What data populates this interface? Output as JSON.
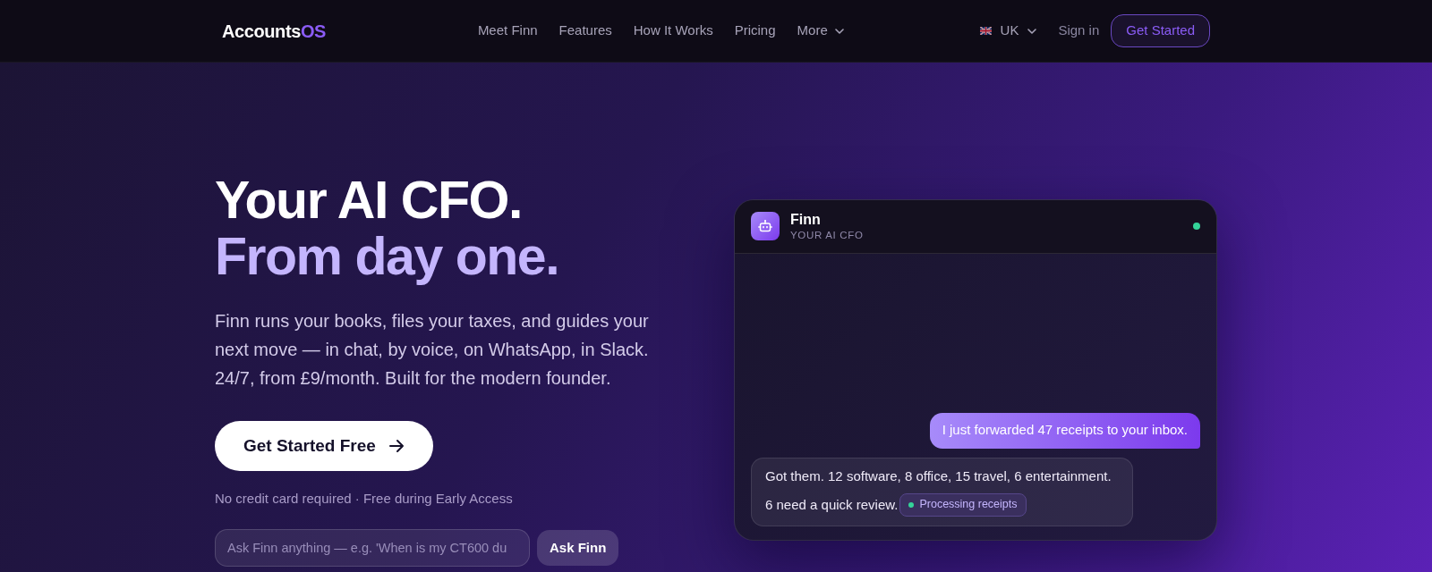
{
  "nav": {
    "logo": {
      "text": "Accounts",
      "accent": "OS"
    },
    "links": [
      {
        "label": "Meet Finn",
        "kind": "link"
      },
      {
        "label": "Features",
        "kind": "link"
      },
      {
        "label": "How It Works",
        "kind": "link"
      },
      {
        "label": "Pricing",
        "kind": "link"
      },
      {
        "label": "More",
        "kind": "dropdown"
      }
    ],
    "region": {
      "label": "UK"
    },
    "sign_in": "Sign in",
    "cta": "Get Started"
  },
  "hero": {
    "headline": {
      "text": "Your AI CFO.",
      "accent": "From day one."
    },
    "description": "Finn runs your books, files your taxes, and guides your next move — in chat, by voice, on WhatsApp, in Slack. 24/7, from £9/month. Built for the modern founder.",
    "primary_button": "Get Started Free",
    "note": "No credit card required · Free during Early Access",
    "ask": {
      "placeholder": "Ask Finn anything — e.g. 'When is my CT600 du",
      "button": "Ask Finn"
    }
  },
  "chat": {
    "name": "Finn",
    "subtitle": "YOUR AI CFO",
    "online": true,
    "messages": [
      {
        "kind": "outgoing",
        "lines": [
          "I just forwarded 47 receipts to your inbox."
        ]
      },
      {
        "kind": "incoming",
        "lines": [
          "Got them. 12 software, 8 office, 15 travel, 6 entertainment.",
          "6 need a quick review."
        ],
        "badge": "Processing receipts"
      }
    ]
  }
}
